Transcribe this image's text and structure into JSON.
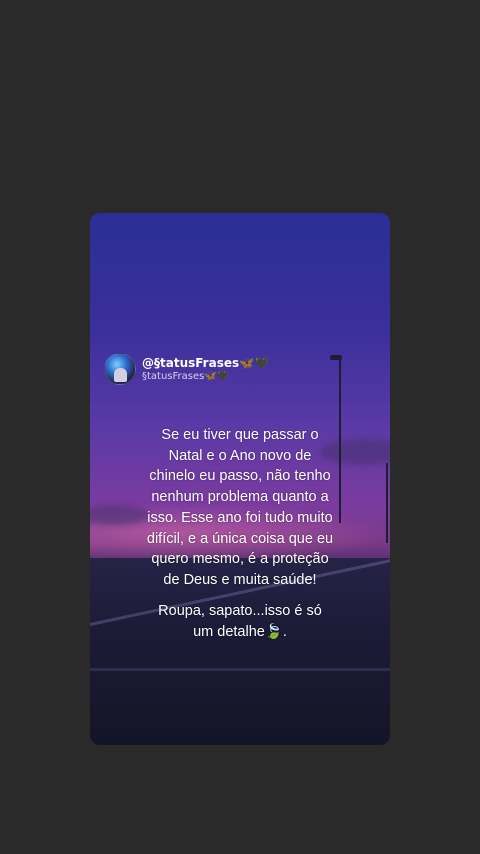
{
  "story": {
    "display_name": "@§tatusFrases🦋🖤",
    "handle": "§tatusFrases🦋🖤",
    "avatar_icon": "profile-avatar",
    "message_lines": [
      "Se eu tiver que passar o",
      "Natal e o Ano novo de",
      "chinelo eu passo, não tenho",
      "nenhum problema quanto a",
      "isso. Esse ano foi tudo muito",
      "difícil, e a única coisa que eu",
      "quero mesmo, é a proteção",
      "de Deus e muita saúde!"
    ],
    "closing_lines": [
      "Roupa, sapato...isso é só",
      "um detalhe🍃."
    ]
  },
  "colors": {
    "page_background": "#2b2a2a",
    "sky_top": "#2a2f95",
    "sky_glow": "#7b3b9f",
    "text": "#ffffff"
  }
}
